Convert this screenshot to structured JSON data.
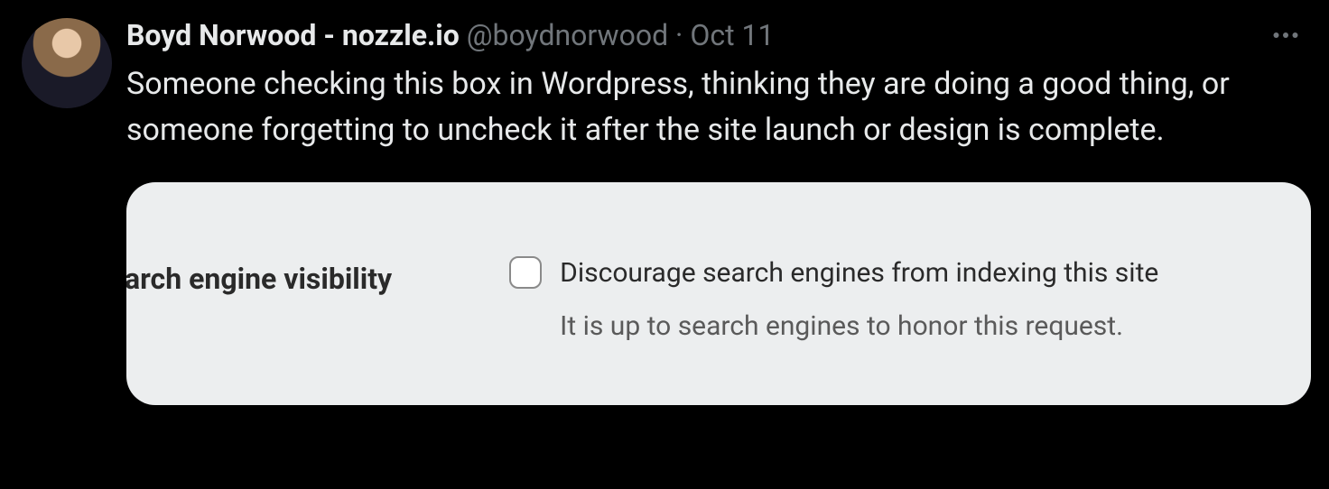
{
  "tweet": {
    "author": {
      "display_name": "Boyd Norwood - nozzle.io",
      "handle": "@boydnorwood",
      "date": "Oct 11"
    },
    "text": "Someone checking this box in Wordpress, thinking they are doing a good thing, or someone forgetting to uncheck it after the site launch or design is complete.",
    "embedded_screenshot": {
      "setting_label": "arch engine visibility",
      "checkbox_label": "Discourage search engines from indexing this site",
      "hint": "It is up to search engines to honor this request."
    }
  }
}
